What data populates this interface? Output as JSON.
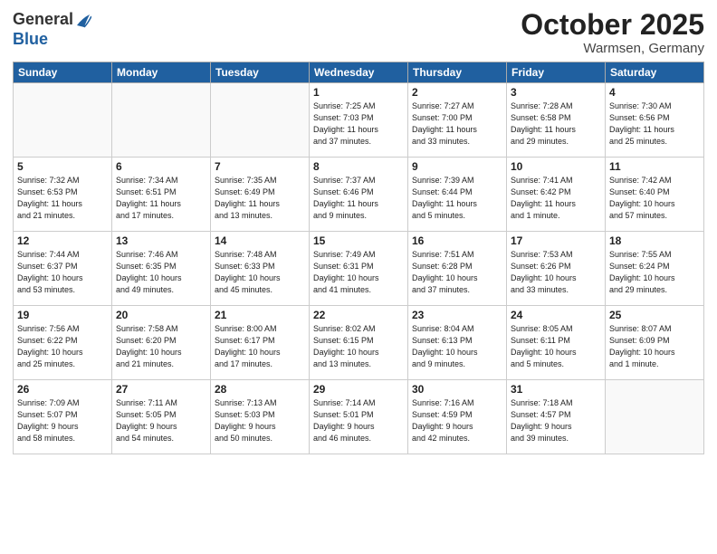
{
  "logo": {
    "general": "General",
    "blue": "Blue"
  },
  "title": "October 2025",
  "location": "Warmsen, Germany",
  "days_of_week": [
    "Sunday",
    "Monday",
    "Tuesday",
    "Wednesday",
    "Thursday",
    "Friday",
    "Saturday"
  ],
  "weeks": [
    [
      {
        "day": "",
        "info": ""
      },
      {
        "day": "",
        "info": ""
      },
      {
        "day": "",
        "info": ""
      },
      {
        "day": "1",
        "info": "Sunrise: 7:25 AM\nSunset: 7:03 PM\nDaylight: 11 hours\nand 37 minutes."
      },
      {
        "day": "2",
        "info": "Sunrise: 7:27 AM\nSunset: 7:00 PM\nDaylight: 11 hours\nand 33 minutes."
      },
      {
        "day": "3",
        "info": "Sunrise: 7:28 AM\nSunset: 6:58 PM\nDaylight: 11 hours\nand 29 minutes."
      },
      {
        "day": "4",
        "info": "Sunrise: 7:30 AM\nSunset: 6:56 PM\nDaylight: 11 hours\nand 25 minutes."
      }
    ],
    [
      {
        "day": "5",
        "info": "Sunrise: 7:32 AM\nSunset: 6:53 PM\nDaylight: 11 hours\nand 21 minutes."
      },
      {
        "day": "6",
        "info": "Sunrise: 7:34 AM\nSunset: 6:51 PM\nDaylight: 11 hours\nand 17 minutes."
      },
      {
        "day": "7",
        "info": "Sunrise: 7:35 AM\nSunset: 6:49 PM\nDaylight: 11 hours\nand 13 minutes."
      },
      {
        "day": "8",
        "info": "Sunrise: 7:37 AM\nSunset: 6:46 PM\nDaylight: 11 hours\nand 9 minutes."
      },
      {
        "day": "9",
        "info": "Sunrise: 7:39 AM\nSunset: 6:44 PM\nDaylight: 11 hours\nand 5 minutes."
      },
      {
        "day": "10",
        "info": "Sunrise: 7:41 AM\nSunset: 6:42 PM\nDaylight: 11 hours\nand 1 minute."
      },
      {
        "day": "11",
        "info": "Sunrise: 7:42 AM\nSunset: 6:40 PM\nDaylight: 10 hours\nand 57 minutes."
      }
    ],
    [
      {
        "day": "12",
        "info": "Sunrise: 7:44 AM\nSunset: 6:37 PM\nDaylight: 10 hours\nand 53 minutes."
      },
      {
        "day": "13",
        "info": "Sunrise: 7:46 AM\nSunset: 6:35 PM\nDaylight: 10 hours\nand 49 minutes."
      },
      {
        "day": "14",
        "info": "Sunrise: 7:48 AM\nSunset: 6:33 PM\nDaylight: 10 hours\nand 45 minutes."
      },
      {
        "day": "15",
        "info": "Sunrise: 7:49 AM\nSunset: 6:31 PM\nDaylight: 10 hours\nand 41 minutes."
      },
      {
        "day": "16",
        "info": "Sunrise: 7:51 AM\nSunset: 6:28 PM\nDaylight: 10 hours\nand 37 minutes."
      },
      {
        "day": "17",
        "info": "Sunrise: 7:53 AM\nSunset: 6:26 PM\nDaylight: 10 hours\nand 33 minutes."
      },
      {
        "day": "18",
        "info": "Sunrise: 7:55 AM\nSunset: 6:24 PM\nDaylight: 10 hours\nand 29 minutes."
      }
    ],
    [
      {
        "day": "19",
        "info": "Sunrise: 7:56 AM\nSunset: 6:22 PM\nDaylight: 10 hours\nand 25 minutes."
      },
      {
        "day": "20",
        "info": "Sunrise: 7:58 AM\nSunset: 6:20 PM\nDaylight: 10 hours\nand 21 minutes."
      },
      {
        "day": "21",
        "info": "Sunrise: 8:00 AM\nSunset: 6:17 PM\nDaylight: 10 hours\nand 17 minutes."
      },
      {
        "day": "22",
        "info": "Sunrise: 8:02 AM\nSunset: 6:15 PM\nDaylight: 10 hours\nand 13 minutes."
      },
      {
        "day": "23",
        "info": "Sunrise: 8:04 AM\nSunset: 6:13 PM\nDaylight: 10 hours\nand 9 minutes."
      },
      {
        "day": "24",
        "info": "Sunrise: 8:05 AM\nSunset: 6:11 PM\nDaylight: 10 hours\nand 5 minutes."
      },
      {
        "day": "25",
        "info": "Sunrise: 8:07 AM\nSunset: 6:09 PM\nDaylight: 10 hours\nand 1 minute."
      }
    ],
    [
      {
        "day": "26",
        "info": "Sunrise: 7:09 AM\nSunset: 5:07 PM\nDaylight: 9 hours\nand 58 minutes."
      },
      {
        "day": "27",
        "info": "Sunrise: 7:11 AM\nSunset: 5:05 PM\nDaylight: 9 hours\nand 54 minutes."
      },
      {
        "day": "28",
        "info": "Sunrise: 7:13 AM\nSunset: 5:03 PM\nDaylight: 9 hours\nand 50 minutes."
      },
      {
        "day": "29",
        "info": "Sunrise: 7:14 AM\nSunset: 5:01 PM\nDaylight: 9 hours\nand 46 minutes."
      },
      {
        "day": "30",
        "info": "Sunrise: 7:16 AM\nSunset: 4:59 PM\nDaylight: 9 hours\nand 42 minutes."
      },
      {
        "day": "31",
        "info": "Sunrise: 7:18 AM\nSunset: 4:57 PM\nDaylight: 9 hours\nand 39 minutes."
      },
      {
        "day": "",
        "info": ""
      }
    ]
  ]
}
